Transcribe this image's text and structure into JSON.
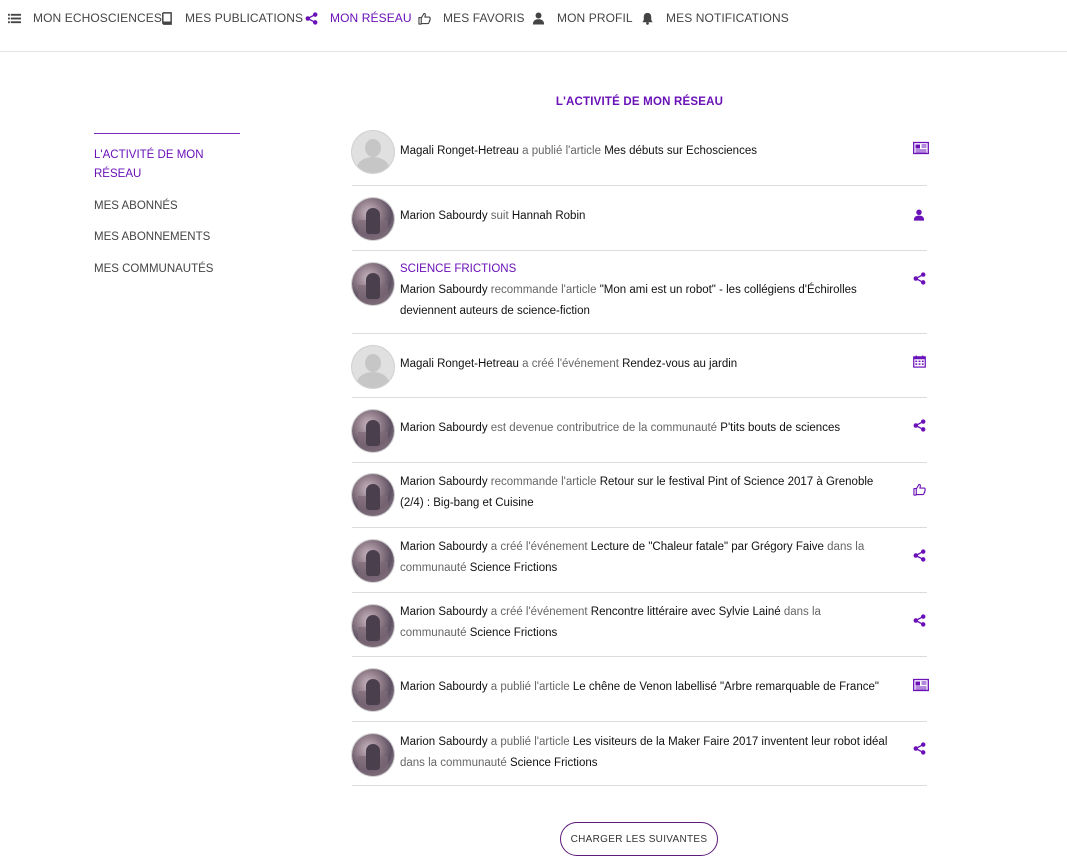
{
  "nav": [
    {
      "id": "mon-echosciences",
      "label": "MON ECHOSCIENCES",
      "icon": "list-icon",
      "active": false
    },
    {
      "id": "mes-publications",
      "label": "MES PUBLICATIONS",
      "icon": "book-icon",
      "active": false
    },
    {
      "id": "mon-reseau",
      "label": "MON RÉSEAU",
      "icon": "share-icon",
      "active": true
    },
    {
      "id": "mes-favoris",
      "label": "MES FAVORIS",
      "icon": "thumbs-up-icon",
      "active": false
    },
    {
      "id": "mon-profil",
      "label": "MON PROFIL",
      "icon": "user-icon",
      "active": false
    },
    {
      "id": "mes-notifications",
      "label": "MES NOTIFICATIONS",
      "icon": "bell-icon",
      "active": false
    }
  ],
  "sidebar": {
    "items": [
      {
        "label": "L'ACTIVITÉ DE MON RÉSEAU",
        "active": true
      },
      {
        "label": "MES ABONNÉS",
        "active": false
      },
      {
        "label": "MES ABONNEMENTS",
        "active": false
      },
      {
        "label": "MES COMMUNAUTÉS",
        "active": false
      }
    ]
  },
  "main": {
    "title": "L'ACTIVITÉ DE MON RÉSEAU",
    "load_more": "CHARGER LES SUIVANTES"
  },
  "colors": {
    "accent": "#6a11b8",
    "button_border": "#5c1a7a"
  },
  "activities": [
    {
      "avatar": "placeholder",
      "icon": "newspaper-icon",
      "parts": [
        {
          "t": "Magali Ronget-Hetreau",
          "b": true
        },
        {
          "t": " a publié l'article "
        },
        {
          "t": "Mes débuts sur Echosciences",
          "b": true
        }
      ]
    },
    {
      "avatar": "photo",
      "icon": "user-icon",
      "parts": [
        {
          "t": "Marion Sabourdy",
          "b": true
        },
        {
          "t": " suit "
        },
        {
          "t": "Hannah Robin",
          "b": true
        }
      ]
    },
    {
      "avatar": "photo",
      "icon": "share-icon",
      "group": "SCIENCE FRICTIONS",
      "parts": [
        {
          "t": "Marion Sabourdy",
          "b": true
        },
        {
          "t": " recommande l'article "
        },
        {
          "t": "\"Mon ami est un robot\" - les collégiens d'Échirolles deviennent auteurs de science-fiction",
          "b": true
        }
      ]
    },
    {
      "avatar": "placeholder",
      "icon": "calendar-icon",
      "parts": [
        {
          "t": "Magali Ronget-Hetreau",
          "b": true
        },
        {
          "t": " a créé l'événement "
        },
        {
          "t": "Rendez-vous au jardin",
          "b": true
        }
      ]
    },
    {
      "avatar": "photo",
      "icon": "share-icon",
      "parts": [
        {
          "t": "Marion Sabourdy",
          "b": true
        },
        {
          "t": " est devenue contributrice de la communauté "
        },
        {
          "t": "P'tits bouts de sciences",
          "b": true
        }
      ]
    },
    {
      "avatar": "photo",
      "icon": "thumbs-up-icon",
      "parts": [
        {
          "t": "Marion Sabourdy",
          "b": true
        },
        {
          "t": " recommande l'article "
        },
        {
          "t": "Retour sur le festival Pint of Science 2017 à Grenoble (2/4) : Big-bang et Cuisine",
          "b": true
        }
      ]
    },
    {
      "avatar": "photo",
      "icon": "share-icon",
      "parts": [
        {
          "t": "Marion Sabourdy",
          "b": true
        },
        {
          "t": " a créé l'événement "
        },
        {
          "t": "Lecture de \"Chaleur fatale\" par Grégory Faive",
          "b": true
        },
        {
          "t": " dans la communauté "
        },
        {
          "t": "Science Frictions",
          "b": true
        }
      ]
    },
    {
      "avatar": "photo",
      "icon": "share-icon",
      "parts": [
        {
          "t": "Marion Sabourdy",
          "b": true
        },
        {
          "t": " a créé l'événement "
        },
        {
          "t": "Rencontre littéraire avec Sylvie Lainé",
          "b": true
        },
        {
          "t": " dans la communauté "
        },
        {
          "t": "Science Frictions",
          "b": true
        }
      ]
    },
    {
      "avatar": "photo",
      "icon": "newspaper-icon",
      "parts": [
        {
          "t": "Marion Sabourdy",
          "b": true
        },
        {
          "t": " a publié l'article "
        },
        {
          "t": "Le chêne de Venon labellisé \"Arbre remarquable de France\"",
          "b": true
        }
      ]
    },
    {
      "avatar": "photo",
      "icon": "share-icon",
      "parts": [
        {
          "t": "Marion Sabourdy",
          "b": true
        },
        {
          "t": " a publié l'article "
        },
        {
          "t": "Les visiteurs de la Maker Faire 2017 inventent leur robot idéal",
          "b": true
        },
        {
          "t": " dans la communauté "
        },
        {
          "t": "Science Frictions",
          "b": true
        }
      ]
    }
  ]
}
